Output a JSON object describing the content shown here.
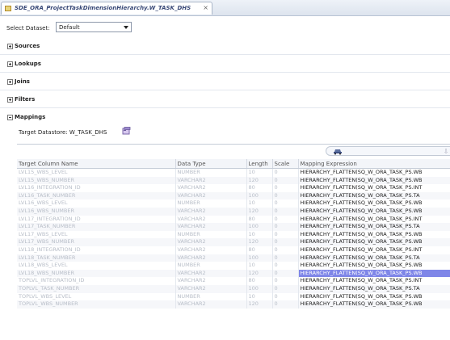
{
  "tab": {
    "title": "SDE_ORA_ProjectTaskDimensionHierarchy.W_TASK_DHS",
    "close": "×"
  },
  "dataset": {
    "label": "Select Dataset:",
    "value": "Default"
  },
  "sections": [
    {
      "label": "Sources",
      "expanded": false
    },
    {
      "label": "Lookups",
      "expanded": false
    },
    {
      "label": "Joins",
      "expanded": false
    },
    {
      "label": "Filters",
      "expanded": false
    },
    {
      "label": "Mappings",
      "expanded": true
    }
  ],
  "target": {
    "label": "Target Datastore: W_TASK_DHS",
    "icon": "datastore-icon"
  },
  "toolbar": {
    "left_icon": "car-icon",
    "right_icons": "⇩⇧"
  },
  "columns": [
    "Target Column Name",
    "Data Type",
    "Length",
    "Scale",
    "Mapping Expression"
  ],
  "rows": [
    {
      "name": "LVL15_WBS_LEVEL",
      "type": "NUMBER",
      "length": "10",
      "scale": "0",
      "expr": "HIERARCHY_FLATTEN(SQ_W_ORA_TASK_PS.WB"
    },
    {
      "name": "LVL15_WBS_NUMBER",
      "type": "VARCHAR2",
      "length": "120",
      "scale": "0",
      "expr": "HIERARCHY_FLATTEN(SQ_W_ORA_TASK_PS.WB"
    },
    {
      "name": "LVL16_INTEGRATION_ID",
      "type": "VARCHAR2",
      "length": "80",
      "scale": "0",
      "expr": "HIERARCHY_FLATTEN(SQ_W_ORA_TASK_PS.INT"
    },
    {
      "name": "LVL16_TASK_NUMBER",
      "type": "VARCHAR2",
      "length": "100",
      "scale": "0",
      "expr": "HIERARCHY_FLATTEN(SQ_W_ORA_TASK_PS.TA"
    },
    {
      "name": "LVL16_WBS_LEVEL",
      "type": "NUMBER",
      "length": "10",
      "scale": "0",
      "expr": "HIERARCHY_FLATTEN(SQ_W_ORA_TASK_PS.WB"
    },
    {
      "name": "LVL16_WBS_NUMBER",
      "type": "VARCHAR2",
      "length": "120",
      "scale": "0",
      "expr": "HIERARCHY_FLATTEN(SQ_W_ORA_TASK_PS.WB"
    },
    {
      "name": "LVL17_INTEGRATION_ID",
      "type": "VARCHAR2",
      "length": "80",
      "scale": "0",
      "expr": "HIERARCHY_FLATTEN(SQ_W_ORA_TASK_PS.INT"
    },
    {
      "name": "LVL17_TASK_NUMBER",
      "type": "VARCHAR2",
      "length": "100",
      "scale": "0",
      "expr": "HIERARCHY_FLATTEN(SQ_W_ORA_TASK_PS.TA"
    },
    {
      "name": "LVL17_WBS_LEVEL",
      "type": "NUMBER",
      "length": "10",
      "scale": "0",
      "expr": "HIERARCHY_FLATTEN(SQ_W_ORA_TASK_PS.WB"
    },
    {
      "name": "LVL17_WBS_NUMBER",
      "type": "VARCHAR2",
      "length": "120",
      "scale": "0",
      "expr": "HIERARCHY_FLATTEN(SQ_W_ORA_TASK_PS.WB"
    },
    {
      "name": "LVL18_INTEGRATION_ID",
      "type": "VARCHAR2",
      "length": "80",
      "scale": "0",
      "expr": "HIERARCHY_FLATTEN(SQ_W_ORA_TASK_PS.INT"
    },
    {
      "name": "LVL18_TASK_NUMBER",
      "type": "VARCHAR2",
      "length": "100",
      "scale": "0",
      "expr": "HIERARCHY_FLATTEN(SQ_W_ORA_TASK_PS.TA"
    },
    {
      "name": "LVL18_WBS_LEVEL",
      "type": "NUMBER",
      "length": "10",
      "scale": "0",
      "expr": "HIERARCHY_FLATTEN(SQ_W_ORA_TASK_PS.WB"
    },
    {
      "name": "LVL18_WBS_NUMBER",
      "type": "VARCHAR2",
      "length": "120",
      "scale": "0",
      "expr": "HIERARCHY_FLATTEN(SQ_W_ORA_TASK_PS.WB",
      "selected": true
    },
    {
      "name": "TOPLVL_INTEGRATION_ID",
      "type": "VARCHAR2",
      "length": "80",
      "scale": "0",
      "expr": "HIERARCHY_FLATTEN(SQ_W_ORA_TASK_PS.INT"
    },
    {
      "name": "TOPLVL_TASK_NUMBER",
      "type": "VARCHAR2",
      "length": "100",
      "scale": "0",
      "expr": "HIERARCHY_FLATTEN(SQ_W_ORA_TASK_PS.TA"
    },
    {
      "name": "TOPLVL_WBS_LEVEL",
      "type": "NUMBER",
      "length": "10",
      "scale": "0",
      "expr": "HIERARCHY_FLATTEN(SQ_W_ORA_TASK_PS.WB"
    },
    {
      "name": "TOPLVL_WBS_NUMBER",
      "type": "VARCHAR2",
      "length": "120",
      "scale": "0",
      "expr": "HIERARCHY_FLATTEN(SQ_W_ORA_TASK_PS.WB"
    }
  ]
}
